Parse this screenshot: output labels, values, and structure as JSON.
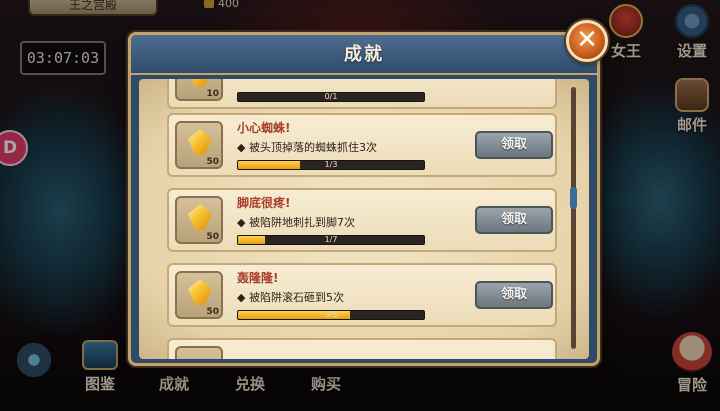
{
  "hud": {
    "location": "王之宫殿",
    "currency": "400",
    "timer": "03:07:03",
    "badge_glyph": "D"
  },
  "side_menu": {
    "queen": "女王",
    "settings": "设置",
    "mail": "邮件",
    "adventure": "冒险"
  },
  "bottom_menu": {
    "gallery": "图鉴",
    "achievements": "成就",
    "exchange": "兑换",
    "shop": "购买"
  },
  "panel": {
    "title": "成就",
    "close_glyph": "✕"
  },
  "achievements": [
    {
      "title": "",
      "description": "",
      "reward": "10",
      "progress_text": "0/1",
      "progress": 0,
      "claim_label": ""
    },
    {
      "title": "小心蜘蛛!",
      "description": "◆ 被头顶掉落的蜘蛛抓住3次",
      "reward": "50",
      "progress_text": "1/3",
      "progress": 0.333,
      "claim_label": "领取"
    },
    {
      "title": "脚底很疼!",
      "description": "◆ 被陷阱地刺扎到脚7次",
      "reward": "50",
      "progress_text": "1/7",
      "progress": 0.143,
      "claim_label": "领取"
    },
    {
      "title": "轰隆隆!",
      "description": "◆ 被陷阱滚石砸到5次",
      "reward": "50",
      "progress_text": "3/5",
      "progress": 0.6,
      "claim_label": "领取"
    },
    {
      "title": "",
      "description": "",
      "reward": "",
      "progress_text": "",
      "progress": 0,
      "claim_label": ""
    }
  ],
  "colors": {
    "panel_frame": "#c4a36a",
    "header": "#2f4c6c",
    "progress_fill": "#f6c230",
    "claim_button": "#7f8890",
    "close_button": "#c85a1a"
  }
}
